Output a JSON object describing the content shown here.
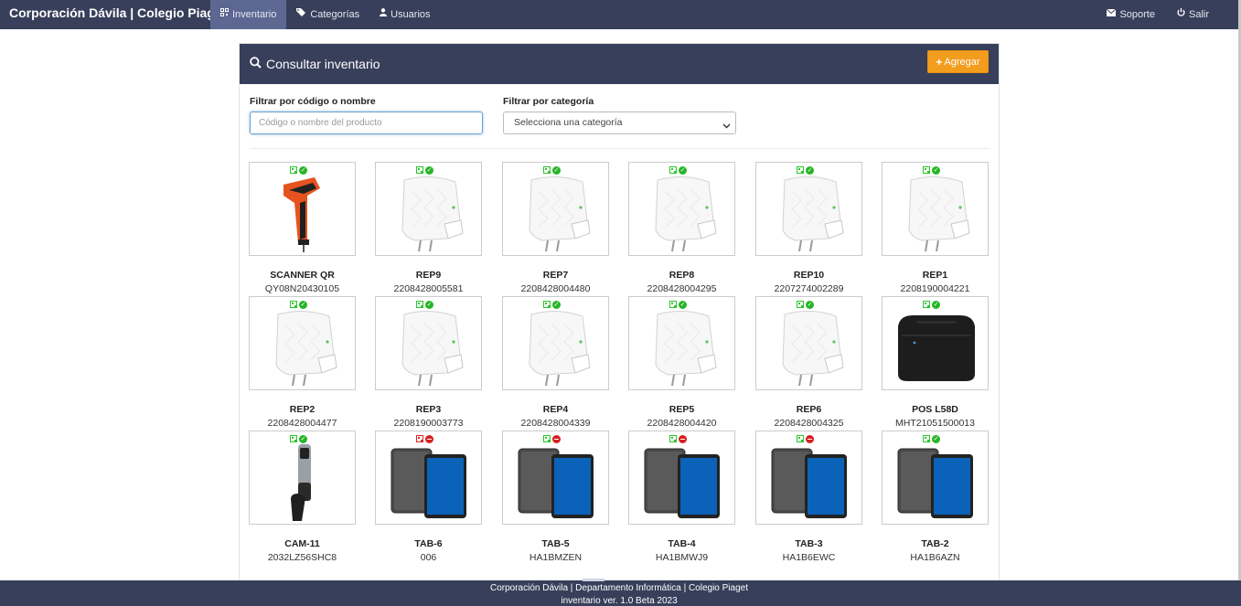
{
  "navbar": {
    "brand": "Corporación Dávila | Colegio Piaget",
    "items": [
      {
        "label": "Inventario",
        "icon": "qrcode-icon"
      },
      {
        "label": "Categorías",
        "icon": "tags-icon"
      },
      {
        "label": "Usuarios",
        "icon": "user-icon"
      }
    ],
    "right": [
      {
        "label": "Soporte",
        "icon": "envelope-icon"
      },
      {
        "label": "Salir",
        "icon": "power-icon"
      }
    ]
  },
  "panel": {
    "title": "Consultar inventario",
    "add_label": "Agregar"
  },
  "filters": {
    "code_label": "Filtrar por código o nombre",
    "code_placeholder": "Código o nombre del producto",
    "category_label": "Filtrar por categoría",
    "category_value": "Selecciona una categoría"
  },
  "products": [
    {
      "name": "SCANNER QR",
      "code": "QY08N20430105",
      "qr": "green",
      "status": "ok",
      "image": "barcode-scanner"
    },
    {
      "name": "REP9",
      "code": "2208428005581",
      "qr": "green",
      "status": "ok",
      "image": "wifi-repeater"
    },
    {
      "name": "REP7",
      "code": "2208428004480",
      "qr": "green",
      "status": "ok",
      "image": "wifi-repeater"
    },
    {
      "name": "REP8",
      "code": "2208428004295",
      "qr": "green",
      "status": "ok",
      "image": "wifi-repeater"
    },
    {
      "name": "REP10",
      "code": "2207274002289",
      "qr": "green",
      "status": "ok",
      "image": "wifi-repeater"
    },
    {
      "name": "REP1",
      "code": "2208190004221",
      "qr": "green",
      "status": "ok",
      "image": "wifi-repeater"
    },
    {
      "name": "REP2",
      "code": "2208428004477",
      "qr": "green",
      "status": "ok",
      "image": "wifi-repeater"
    },
    {
      "name": "REP3",
      "code": "2208190003773",
      "qr": "green",
      "status": "ok",
      "image": "wifi-repeater"
    },
    {
      "name": "REP4",
      "code": "2208428004339",
      "qr": "green",
      "status": "ok",
      "image": "wifi-repeater"
    },
    {
      "name": "REP5",
      "code": "2208428004420",
      "qr": "green",
      "status": "ok",
      "image": "wifi-repeater"
    },
    {
      "name": "REP6",
      "code": "2208428004325",
      "qr": "green",
      "status": "ok",
      "image": "wifi-repeater"
    },
    {
      "name": "POS L58D",
      "code": "MHT21051500013",
      "qr": "green",
      "status": "ok",
      "image": "receipt-printer"
    },
    {
      "name": "CAM-11",
      "code": "2032LZ56SHC8",
      "qr": "green",
      "status": "ok",
      "image": "conference-camera"
    },
    {
      "name": "TAB-6",
      "code": "006",
      "qr": "red",
      "status": "blocked",
      "image": "tablet"
    },
    {
      "name": "TAB-5",
      "code": "HA1BMZEN",
      "qr": "green",
      "status": "blocked",
      "image": "tablet"
    },
    {
      "name": "TAB-4",
      "code": "HA1BMWJ9",
      "qr": "green",
      "status": "blocked",
      "image": "tablet"
    },
    {
      "name": "TAB-3",
      "code": "HA1B6EWC",
      "qr": "green",
      "status": "blocked",
      "image": "tablet"
    },
    {
      "name": "TAB-2",
      "code": "HA1B6AZN",
      "qr": "green",
      "status": "ok",
      "image": "tablet"
    }
  ],
  "footer": {
    "line1": "Corporación Dávila | Departamento Informática | Colegio Piaget",
    "line2": "inventario ver. 1.0 Beta 2023"
  },
  "colors": {
    "navbar": "#373f5a",
    "nav_active": "#5c6792",
    "accent": "#f29d1d",
    "ok": "#27b527",
    "blocked": "#d62020"
  }
}
